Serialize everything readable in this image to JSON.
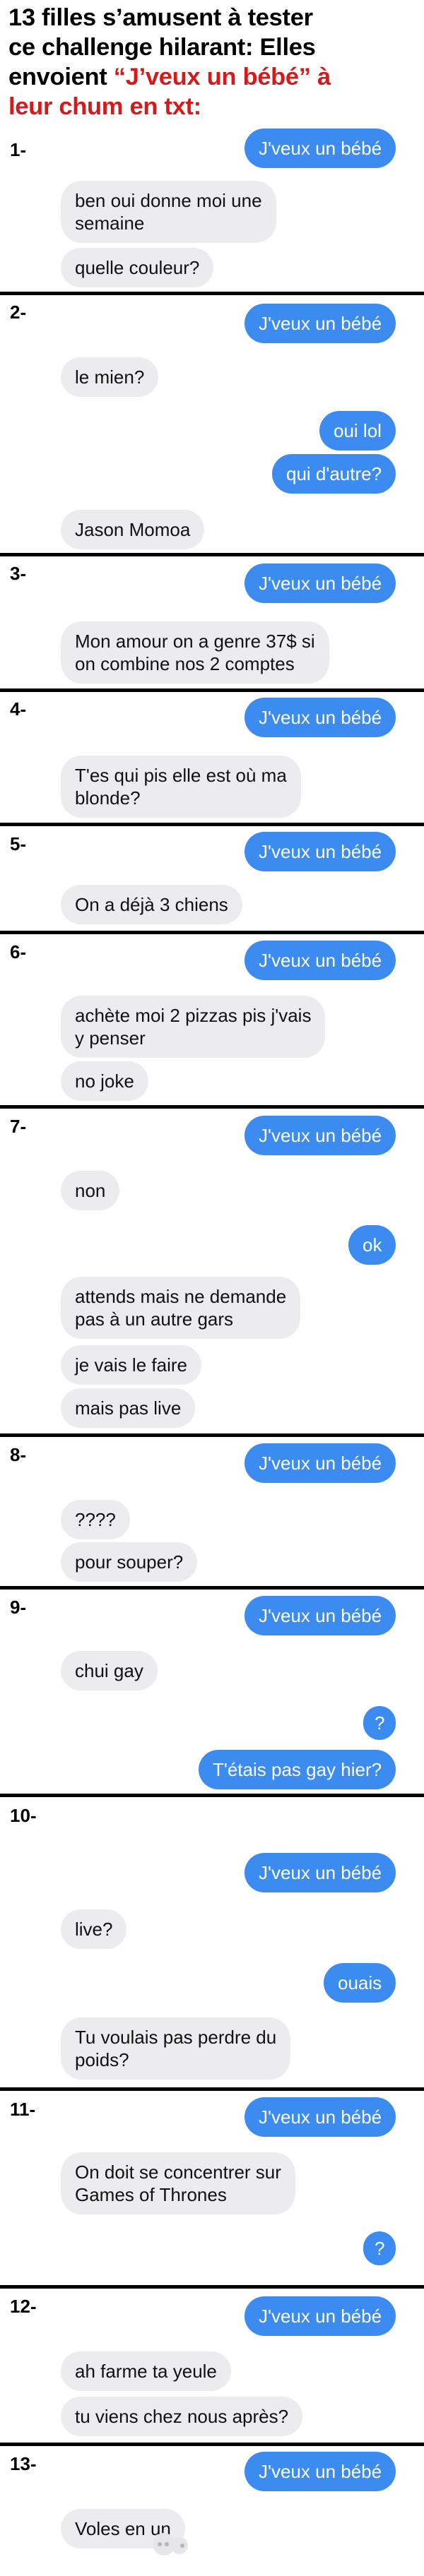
{
  "header": {
    "title_lines": [
      "13 filles s’amusent à tester",
      "ce challenge hilarant: Elles",
      "envoient",
      "“J’veux un bébé” à",
      "leur chum en txt:"
    ]
  },
  "colors": {
    "sent": "#3b8bf0",
    "received": "#ececee",
    "highlight": "#d41a1a"
  },
  "conversations": [
    {
      "label": "1-",
      "messages": [
        {
          "from": "me",
          "text": "J'veux un bébé"
        },
        {
          "from": "them",
          "text": "ben oui donne moi une\nsemaine"
        },
        {
          "from": "them",
          "text": "quelle couleur?"
        }
      ]
    },
    {
      "label": "2-",
      "messages": [
        {
          "from": "me",
          "text": "J'veux un bébé"
        },
        {
          "from": "them",
          "text": "le mien?"
        },
        {
          "from": "me",
          "text": "oui lol"
        },
        {
          "from": "me",
          "text": "qui d'autre?"
        },
        {
          "from": "them",
          "text": "Jason Momoa"
        }
      ]
    },
    {
      "label": "3-",
      "messages": [
        {
          "from": "me",
          "text": "J'veux un bébé"
        },
        {
          "from": "them",
          "text": "Mon amour on a genre 37$ si\non combine nos 2 comptes"
        }
      ]
    },
    {
      "label": "4-",
      "messages": [
        {
          "from": "me",
          "text": "J'veux un bébé"
        },
        {
          "from": "them",
          "text": "T'es qui pis elle est où ma\nblonde?"
        }
      ]
    },
    {
      "label": "5-",
      "messages": [
        {
          "from": "me",
          "text": "J'veux un bébé"
        },
        {
          "from": "them",
          "text": "On a déjà 3 chiens"
        }
      ]
    },
    {
      "label": "6-",
      "messages": [
        {
          "from": "me",
          "text": "J'veux un bébé"
        },
        {
          "from": "them",
          "text": "achète moi 2 pizzas pis j'vais\ny penser"
        },
        {
          "from": "them",
          "text": "no joke"
        }
      ]
    },
    {
      "label": "7-",
      "messages": [
        {
          "from": "me",
          "text": "J'veux un bébé"
        },
        {
          "from": "them",
          "text": "non"
        },
        {
          "from": "me",
          "text": "ok"
        },
        {
          "from": "them",
          "text": "attends mais ne demande\npas à un autre gars"
        },
        {
          "from": "them",
          "text": "je vais le faire"
        },
        {
          "from": "them",
          "text": "mais pas live"
        }
      ]
    },
    {
      "label": "8-",
      "messages": [
        {
          "from": "me",
          "text": "J'veux un bébé"
        },
        {
          "from": "them",
          "text": "????"
        },
        {
          "from": "them",
          "text": "pour souper?"
        }
      ]
    },
    {
      "label": "9-",
      "messages": [
        {
          "from": "me",
          "text": "J'veux un bébé"
        },
        {
          "from": "them",
          "text": "chui gay"
        },
        {
          "from": "me",
          "text": "?"
        },
        {
          "from": "me",
          "text": "T'étais pas gay hier?"
        }
      ]
    },
    {
      "label": "10-",
      "messages": [
        {
          "from": "me",
          "text": "J'veux un bébé"
        },
        {
          "from": "them",
          "text": "live?"
        },
        {
          "from": "me",
          "text": "ouais"
        },
        {
          "from": "them",
          "text": "Tu voulais pas perdre du\npoids?"
        }
      ]
    },
    {
      "label": "11-",
      "messages": [
        {
          "from": "me",
          "text": "J'veux un bébé"
        },
        {
          "from": "them",
          "text": "On doit se concentrer sur\nGames of Thrones"
        },
        {
          "from": "me",
          "text": "?"
        }
      ]
    },
    {
      "label": "12-",
      "messages": [
        {
          "from": "me",
          "text": "J'veux un bébé"
        },
        {
          "from": "them",
          "text": "ah farme ta yeule"
        },
        {
          "from": "them",
          "text": "tu viens chez nous après?"
        }
      ]
    },
    {
      "label": "13-",
      "messages": [
        {
          "from": "me",
          "text": "J'veux un bébé"
        },
        {
          "from": "them",
          "text": "Voles en un"
        }
      ]
    }
  ]
}
